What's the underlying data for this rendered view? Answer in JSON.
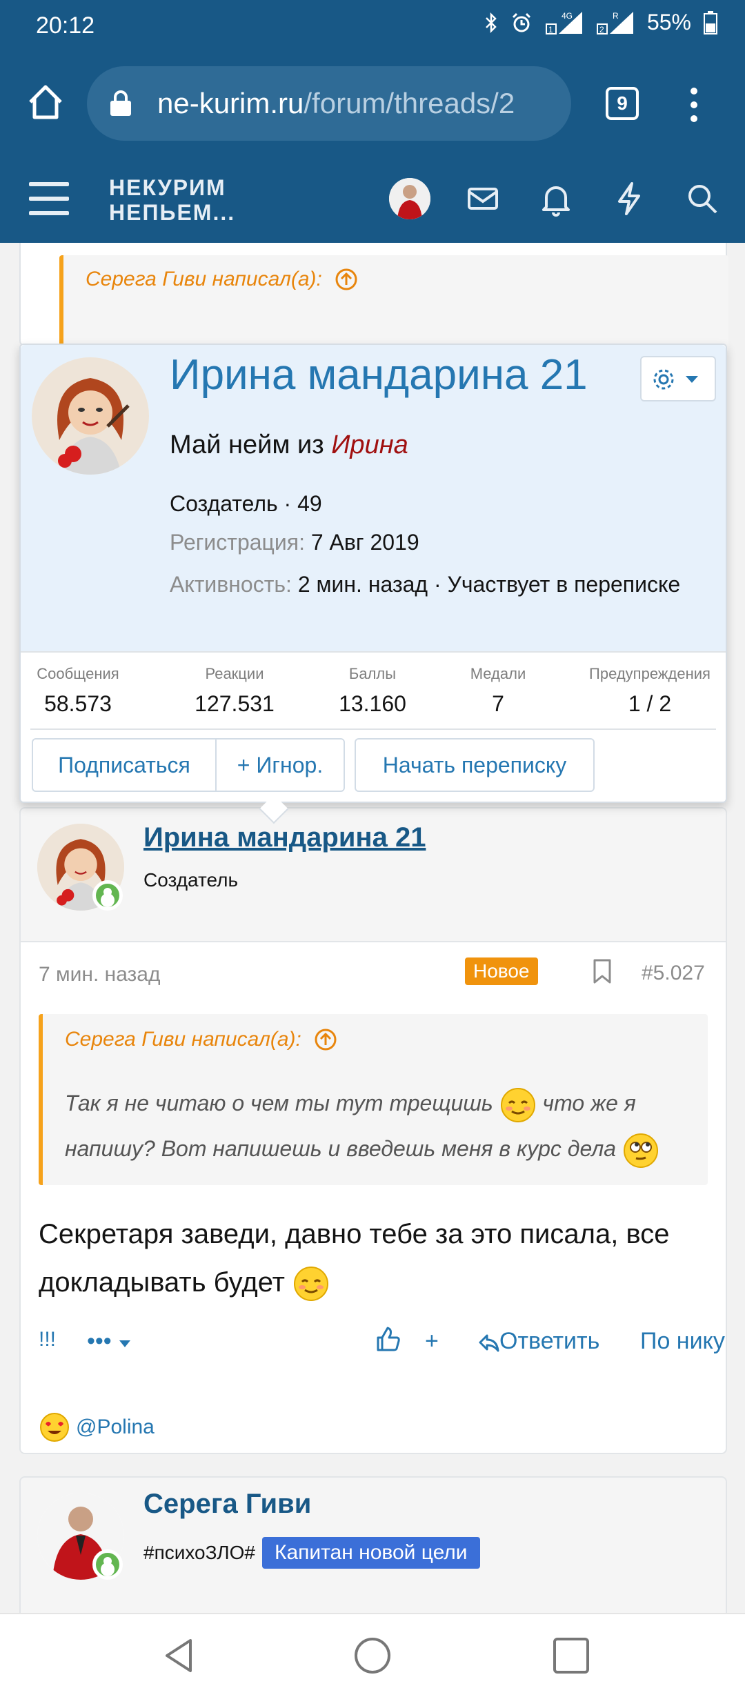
{
  "status_bar": {
    "time": "20:12",
    "battery": "55%",
    "network": "4G",
    "roaming": "R"
  },
  "browser": {
    "url_domain": "ne-kurim.ru",
    "url_path": "/forum/threads/2",
    "tab_count": "9"
  },
  "site_header": {
    "logo_line1": "НЕКУРИМ",
    "logo_line2": "НЕПЬЕМ..."
  },
  "top_quote": {
    "author": "Серега Гиви написал(а):"
  },
  "popup": {
    "name": "Ирина мандарина 21",
    "title_prefix": "Май нейм из",
    "title_name": "Ирина",
    "role_line": "Создатель · 49",
    "reg_label": "Регистрация:",
    "reg_value": "7 Авг 2019",
    "activity_label": "Активность:",
    "activity_value": "2 мин. назад · Участвует в переписке",
    "stats": [
      {
        "label": "Сообщения",
        "value": "58.573"
      },
      {
        "label": "Реакции",
        "value": "127.531"
      },
      {
        "label": "Баллы",
        "value": "13.160"
      },
      {
        "label": "Медали",
        "value": "7"
      },
      {
        "label": "Предупреждения",
        "value": "1 / 2"
      }
    ],
    "buttons": {
      "follow": "Подписаться",
      "ignore": "+ Игнор.",
      "conversation": "Начать переписку"
    }
  },
  "post": {
    "author": "Ирина мандарина 21",
    "role": "Создатель",
    "time": "7 мин. назад",
    "badge": "Новое",
    "number": "#5.027",
    "quote_author": "Серега Гиви написал(а):",
    "quote_part1": "Так я не читаю о чем ты тут трещишь",
    "quote_part2": "что же я напишу? Вот напишешь и введешь меня в курс дела",
    "message_part1": "Секретаря заведи, давно тебе за это писала, все докладывать будет",
    "actions": {
      "report": "!!!",
      "more": "•••",
      "plus": "+",
      "reply": "Ответить",
      "by_nick": "По нику"
    },
    "reaction_user": "@Polina"
  },
  "next_post": {
    "author": "Серега Гиви",
    "role": "#психоЗЛО#",
    "banner": "Капитан новой цели"
  },
  "colors": {
    "header_bg": "#185886",
    "link": "#2577b1",
    "quote_accent": "#f6a21b",
    "badge_new": "#f0930d",
    "online": "#63b651",
    "banner": "#3b6fd8"
  }
}
